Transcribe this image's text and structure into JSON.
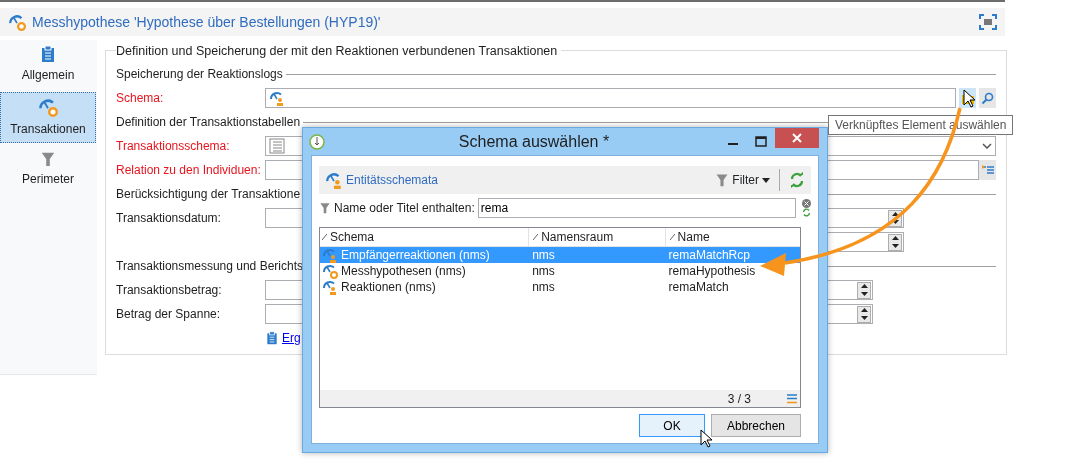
{
  "header": {
    "title": "Messhypothese 'Hypothese über Bestellungen (HYP19)'"
  },
  "sidebar": {
    "items": [
      {
        "label": "Allgemein",
        "kind": "clipboard",
        "selected": false
      },
      {
        "label": "Transaktionen",
        "kind": "hypothesis",
        "selected": true
      },
      {
        "label": "Perimeter",
        "kind": "funnel",
        "selected": false
      }
    ]
  },
  "form": {
    "legend": "Definition und Speicherung der mit den Reaktionen verbundenen Transaktionen",
    "sections": [
      {
        "title": "Speicherung der Reaktionslogs",
        "fields": [
          {
            "label": "Schema:",
            "required": true,
            "kind": "schema"
          }
        ]
      },
      {
        "title": "Definition der Transaktionstabellen",
        "fields": [
          {
            "label": "Transaktionsschema:",
            "required": true,
            "kind": "select"
          },
          {
            "label": "Relation zu den Individuen:",
            "required": true,
            "kind": "relation"
          }
        ]
      },
      {
        "title": "Berücksichtigung der Transaktione",
        "fields": [
          {
            "label": "Transaktionsdatum:",
            "required": false,
            "kind": "datetime"
          },
          {
            "kind": "time"
          }
        ]
      },
      {
        "title": "Transaktionsmessung und Berichts",
        "fields": [
          {
            "label": "Transaktionsbetrag:",
            "required": false,
            "kind": "number"
          },
          {
            "label": "Betrag der Spanne:",
            "required": false,
            "kind": "number"
          }
        ]
      }
    ],
    "link": "Erg"
  },
  "tooltip": "Verknüpftes Element auswählen",
  "dialog": {
    "title": "Schema auswählen *",
    "toolbar": {
      "title": "Entitätsschemata",
      "filter_button": "Filter"
    },
    "filter": {
      "label": "Name oder Titel enthalten:",
      "value": "rema"
    },
    "table": {
      "columns": [
        "Schema",
        "Namensraum",
        "Name"
      ],
      "rows": [
        {
          "kind": "reaction",
          "selected": true,
          "cells": [
            "Empfängerreaktionen (nms)",
            "nms",
            "remaMatchRcp"
          ]
        },
        {
          "kind": "hypothesis",
          "selected": false,
          "cells": [
            "Messhypothesen (nms)",
            "nms",
            "remaHypothesis"
          ]
        },
        {
          "kind": "reaction",
          "selected": false,
          "cells": [
            "Reaktionen (nms)",
            "nms",
            "remaMatch"
          ]
        }
      ]
    },
    "count": "3 / 3",
    "buttons": [
      {
        "label": "OK",
        "default": true
      },
      {
        "label": "Abbrechen",
        "default": false
      }
    ]
  }
}
